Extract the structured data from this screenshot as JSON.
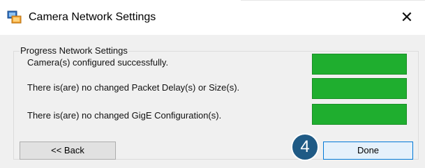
{
  "window": {
    "title": "Camera Network Settings",
    "close_glyph": "✕"
  },
  "group": {
    "title": "Progress Network Settings",
    "rows": [
      {
        "label": "Camera(s) configured successfully.",
        "status_color": "#1fae2f"
      },
      {
        "label": "There is(are) no changed Packet Delay(s) or Size(s).",
        "status_color": "#1fae2f"
      },
      {
        "label": "There is(are) no changed GigE Configuration(s).",
        "status_color": "#1fae2f"
      }
    ]
  },
  "buttons": {
    "back_label": "<< Back",
    "done_label": "Done"
  },
  "step_badge": "4",
  "colors": {
    "success_green": "#1fae2f",
    "badge_blue": "#1f5a85",
    "focus_blue": "#0078d7"
  }
}
